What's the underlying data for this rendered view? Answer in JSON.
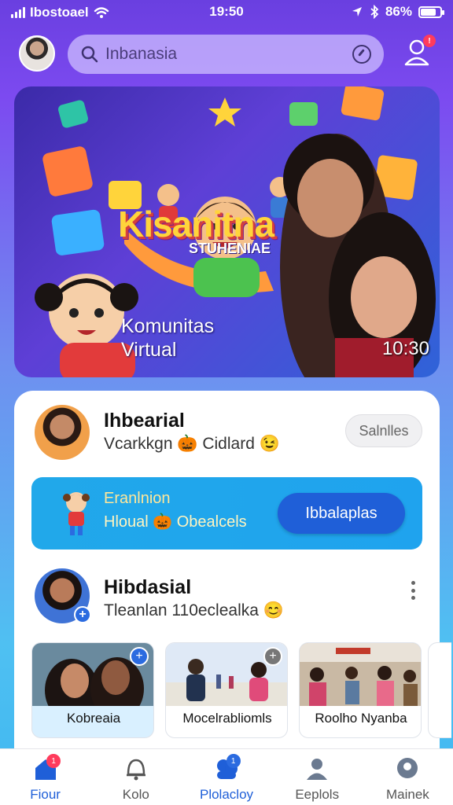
{
  "status_bar": {
    "carrier": "Ibostoael",
    "time": "19:50",
    "battery": "86%",
    "battery_level": 0.86
  },
  "top_bar": {
    "search_placeholder": "Inbanasia"
  },
  "hero": {
    "title": "Kisanitna",
    "subtitle": "STUHENIAE",
    "caption": "Komunitas Virtual",
    "duration": "10:30"
  },
  "feed": {
    "item1": {
      "name": "Ihbearial",
      "subtitle": "Vcarkkgn 🎃 Cidlard 😉",
      "action_label": "Salnlles"
    },
    "promo": {
      "line1": "Eranlnion",
      "line2": "Hloual 🎃 Obealcels",
      "button_label": "Ibbalaplas"
    },
    "item2": {
      "name": "Hibdasial",
      "subtitle": "Tleanlan 110eclealka 😊"
    },
    "thumbnails": [
      {
        "label": "Kobreaia"
      },
      {
        "label": "Mocelrabliomls"
      },
      {
        "label": "Roolho Nyanba"
      }
    ]
  },
  "bottom_nav": {
    "items": [
      {
        "label": "Fiour",
        "icon": "home-icon",
        "badge": "1"
      },
      {
        "label": "Kolo",
        "icon": "bell-icon"
      },
      {
        "label": "Plolacloy",
        "icon": "community-icon",
        "badge": "1"
      },
      {
        "label": "Eeplols",
        "icon": "profile-icon"
      },
      {
        "label": "Mainek",
        "icon": "location-icon"
      }
    ],
    "active_index": 2
  },
  "colors": {
    "accent": "#1f5fd8",
    "promo_bg": "#21a8ea",
    "header_gradient_top": "#6a3fe0",
    "header_gradient_bottom": "#3fb7f0"
  }
}
